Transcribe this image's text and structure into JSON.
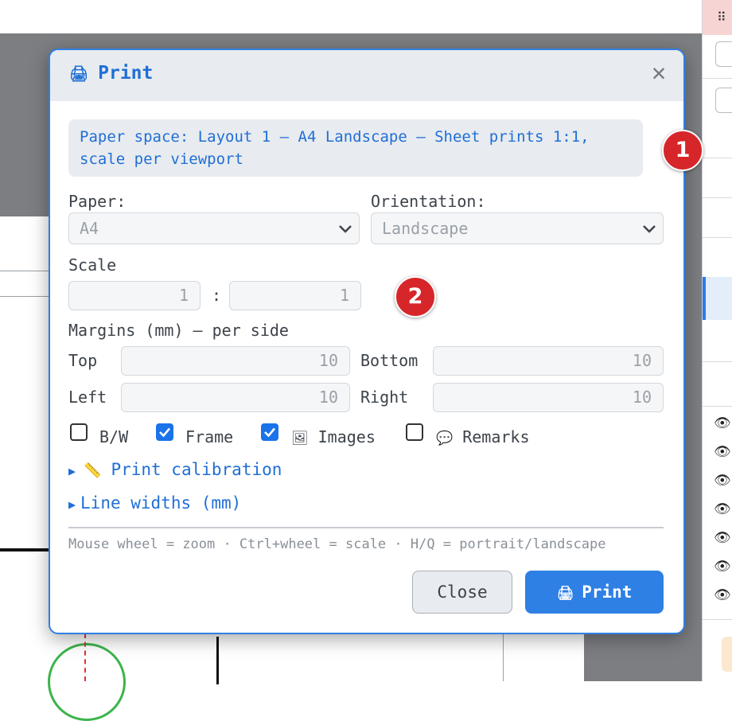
{
  "dialog": {
    "title": "Print",
    "title_icon": "printer-icon",
    "close_icon": "close-icon",
    "info_text": "Paper space: Layout 1 – A4 Landscape – Sheet prints 1:1, scale per viewport",
    "paper": {
      "label": "Paper:",
      "value": "A4"
    },
    "orientation": {
      "label": "Orientation:",
      "value": "Landscape"
    },
    "scale": {
      "label": "Scale",
      "left": "1",
      "separator": ":",
      "right": "1"
    },
    "margins": {
      "label": "Margins (mm) – per side",
      "top_label": "Top",
      "top_value": "10",
      "bottom_label": "Bottom",
      "bottom_value": "10",
      "left_label": "Left",
      "left_value": "10",
      "right_label": "Right",
      "right_value": "10"
    },
    "options": [
      {
        "label": "B/W",
        "checked": false,
        "icon": ""
      },
      {
        "label": "Frame",
        "checked": true,
        "icon": ""
      },
      {
        "label": "Images",
        "checked": true,
        "icon": "🖼"
      },
      {
        "label": "Remarks",
        "checked": false,
        "icon": "💬"
      }
    ],
    "calibration_icon": "📏",
    "calibration_label": "Print calibration",
    "line_widths_label": "Line widths (mm)",
    "hint": "Mouse wheel = zoom · Ctrl+wheel = scale · H/Q = portrait/landscape",
    "close_button": "Close",
    "print_button": "Print"
  },
  "badges": [
    "1",
    "2"
  ],
  "colors": {
    "accent": "#2f80e4",
    "badge": "#d7262a",
    "header": "#e8ebef"
  }
}
